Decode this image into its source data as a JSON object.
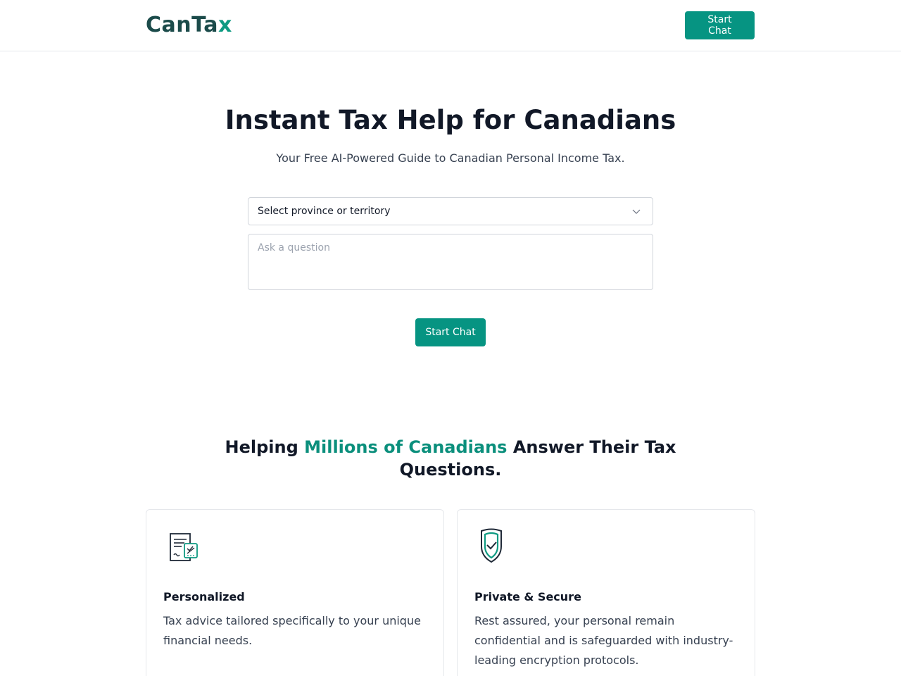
{
  "header": {
    "logo_main": "CanTa",
    "logo_accent": "x",
    "cta_label": "Start Chat"
  },
  "hero": {
    "title": "Instant Tax Help for Canadians",
    "subtitle": "Your Free AI-Powered Guide to Canadian Personal Income Tax."
  },
  "form": {
    "province_select": {
      "selected": "Select province or territory"
    },
    "question_placeholder": "Ask a question",
    "submit_label": "Start Chat"
  },
  "section": {
    "title_before": "Helping ",
    "title_highlight": "Millions of Canadians",
    "title_after": " Answer Their Tax Questions."
  },
  "cards": [
    {
      "icon": "personalized-document-icon",
      "title": "Personalized",
      "description": "Tax advice tailored specifically to your unique financial needs."
    },
    {
      "icon": "shield-check-icon",
      "title": "Private & Secure",
      "description": "Rest assured, your personal remain confidential and is safeguarded with industry-leading encryption protocols."
    }
  ],
  "colors": {
    "brand": "#069482",
    "logo_dark": "#1b4b4a",
    "text": "#111827"
  }
}
